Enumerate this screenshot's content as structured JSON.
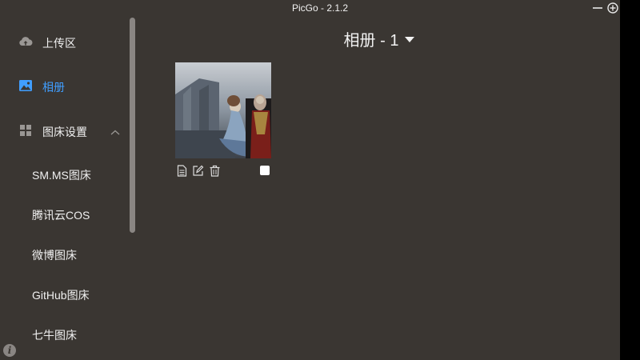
{
  "window": {
    "title": "PicGo - 2.1.2",
    "minimize_icon": "minimize-icon",
    "add_icon": "circle-plus-icon"
  },
  "sidebar": {
    "items": [
      {
        "label": "上传区",
        "icon": "cloud-upload-icon",
        "active": false
      },
      {
        "label": "相册",
        "icon": "image-icon",
        "active": true
      },
      {
        "label": "图床设置",
        "icon": "grid-icon",
        "expanded": true
      }
    ],
    "subitems": [
      {
        "label": "SM.MS图床"
      },
      {
        "label": "腾讯云COS"
      },
      {
        "label": "微博图床"
      },
      {
        "label": "GitHub图床"
      },
      {
        "label": "七牛图床"
      }
    ]
  },
  "gallery": {
    "heading": "相册 - 1",
    "images": [
      {
        "alt": "fantasy-artwork-thumbnail",
        "selected": false
      }
    ]
  },
  "colors": {
    "background": "#3a3632",
    "accent": "#409eff",
    "text": "#f0f0f0"
  }
}
